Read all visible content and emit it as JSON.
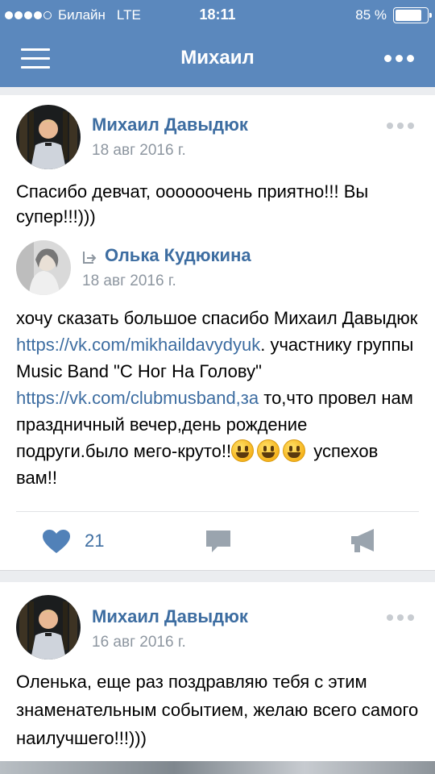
{
  "status_bar": {
    "carrier": "Билайн",
    "network": "LTE",
    "time": "18:11",
    "battery_text": "85 %",
    "battery_level": 0.85,
    "signal_bars": 4
  },
  "navbar": {
    "title": "Михаил",
    "menu_icon": "hamburger-menu-icon",
    "more_icon": "more-dots-icon"
  },
  "posts": [
    {
      "author": "Михаил Давыдюк",
      "date": "18 авг 2016 г.",
      "text": "Спасибо девчат, оооооочень приятно!!! Вы супер!!!)))",
      "repost": {
        "author": "Олька Кудюкина",
        "date": "18 авг 2016 г.",
        "text_1": "хочу сказать большое спасибо Михаил Давыдюк ",
        "link_1": "https://vk.com/mikhaildavydyuk",
        "text_2": ". участнику группы Music Band \"С Ног На Голову\" ",
        "link_2": "https://vk.com/clubmusband,за",
        "text_3": " то,что провел нам праздничный вечер,день рождение подруги.было мего-круто!!",
        "text_4": " успехов вам!!"
      },
      "likes": "21",
      "liked": true
    },
    {
      "author": "Михаил Давыдюк",
      "date": "16 авг 2016 г.",
      "text": "Оленька, еще раз поздравляю тебя с этим знаменательным событием, желаю всего самого наилучшего!!!)))"
    }
  ],
  "colors": {
    "header": "#5b88bd",
    "link": "#3d6da1",
    "like": "#5181b8",
    "background": "#ebedf0"
  }
}
